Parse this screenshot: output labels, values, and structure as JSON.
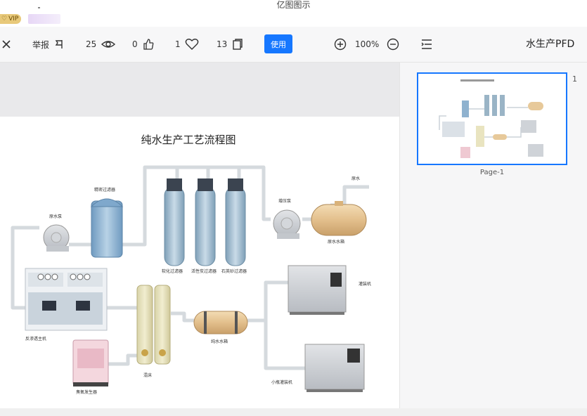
{
  "window": {
    "app_title": "亿图图示",
    "vip_label": "VIP"
  },
  "toolbar": {
    "doc_title": "水生产PFD",
    "zoom": "100%",
    "use_label": "使用",
    "pages_count": "13",
    "likes_count": "1",
    "thumbs_count": "0",
    "views_count": "25",
    "report_label": "举报"
  },
  "diagram": {
    "title": "纯水生产工艺流程图",
    "labels": {
      "raw_water": "原水",
      "raw_pump": "原水泵",
      "precision_filter": "精密过滤器",
      "quartz_filter": "石英砂过滤器",
      "carbon_filter": "活性炭过滤器",
      "softener": "软化过滤器",
      "booster_pump": "增压泵",
      "raw_tank": "原水水箱",
      "ro_unit": "反渗透主机",
      "mixed_bed": "混床",
      "pure_tank": "纯水水箱",
      "ozone": "臭氧发生器",
      "filler_1": "灌装机",
      "filler_2": "小瓶灌装机"
    }
  },
  "panel": {
    "page_number": "1",
    "page_name": "Page-1"
  },
  "colors": {
    "accent": "#1677ff",
    "pipe": "#d8dde2",
    "tank_blue": "#8fb2cf",
    "tank_tan": "#e7c99a"
  }
}
